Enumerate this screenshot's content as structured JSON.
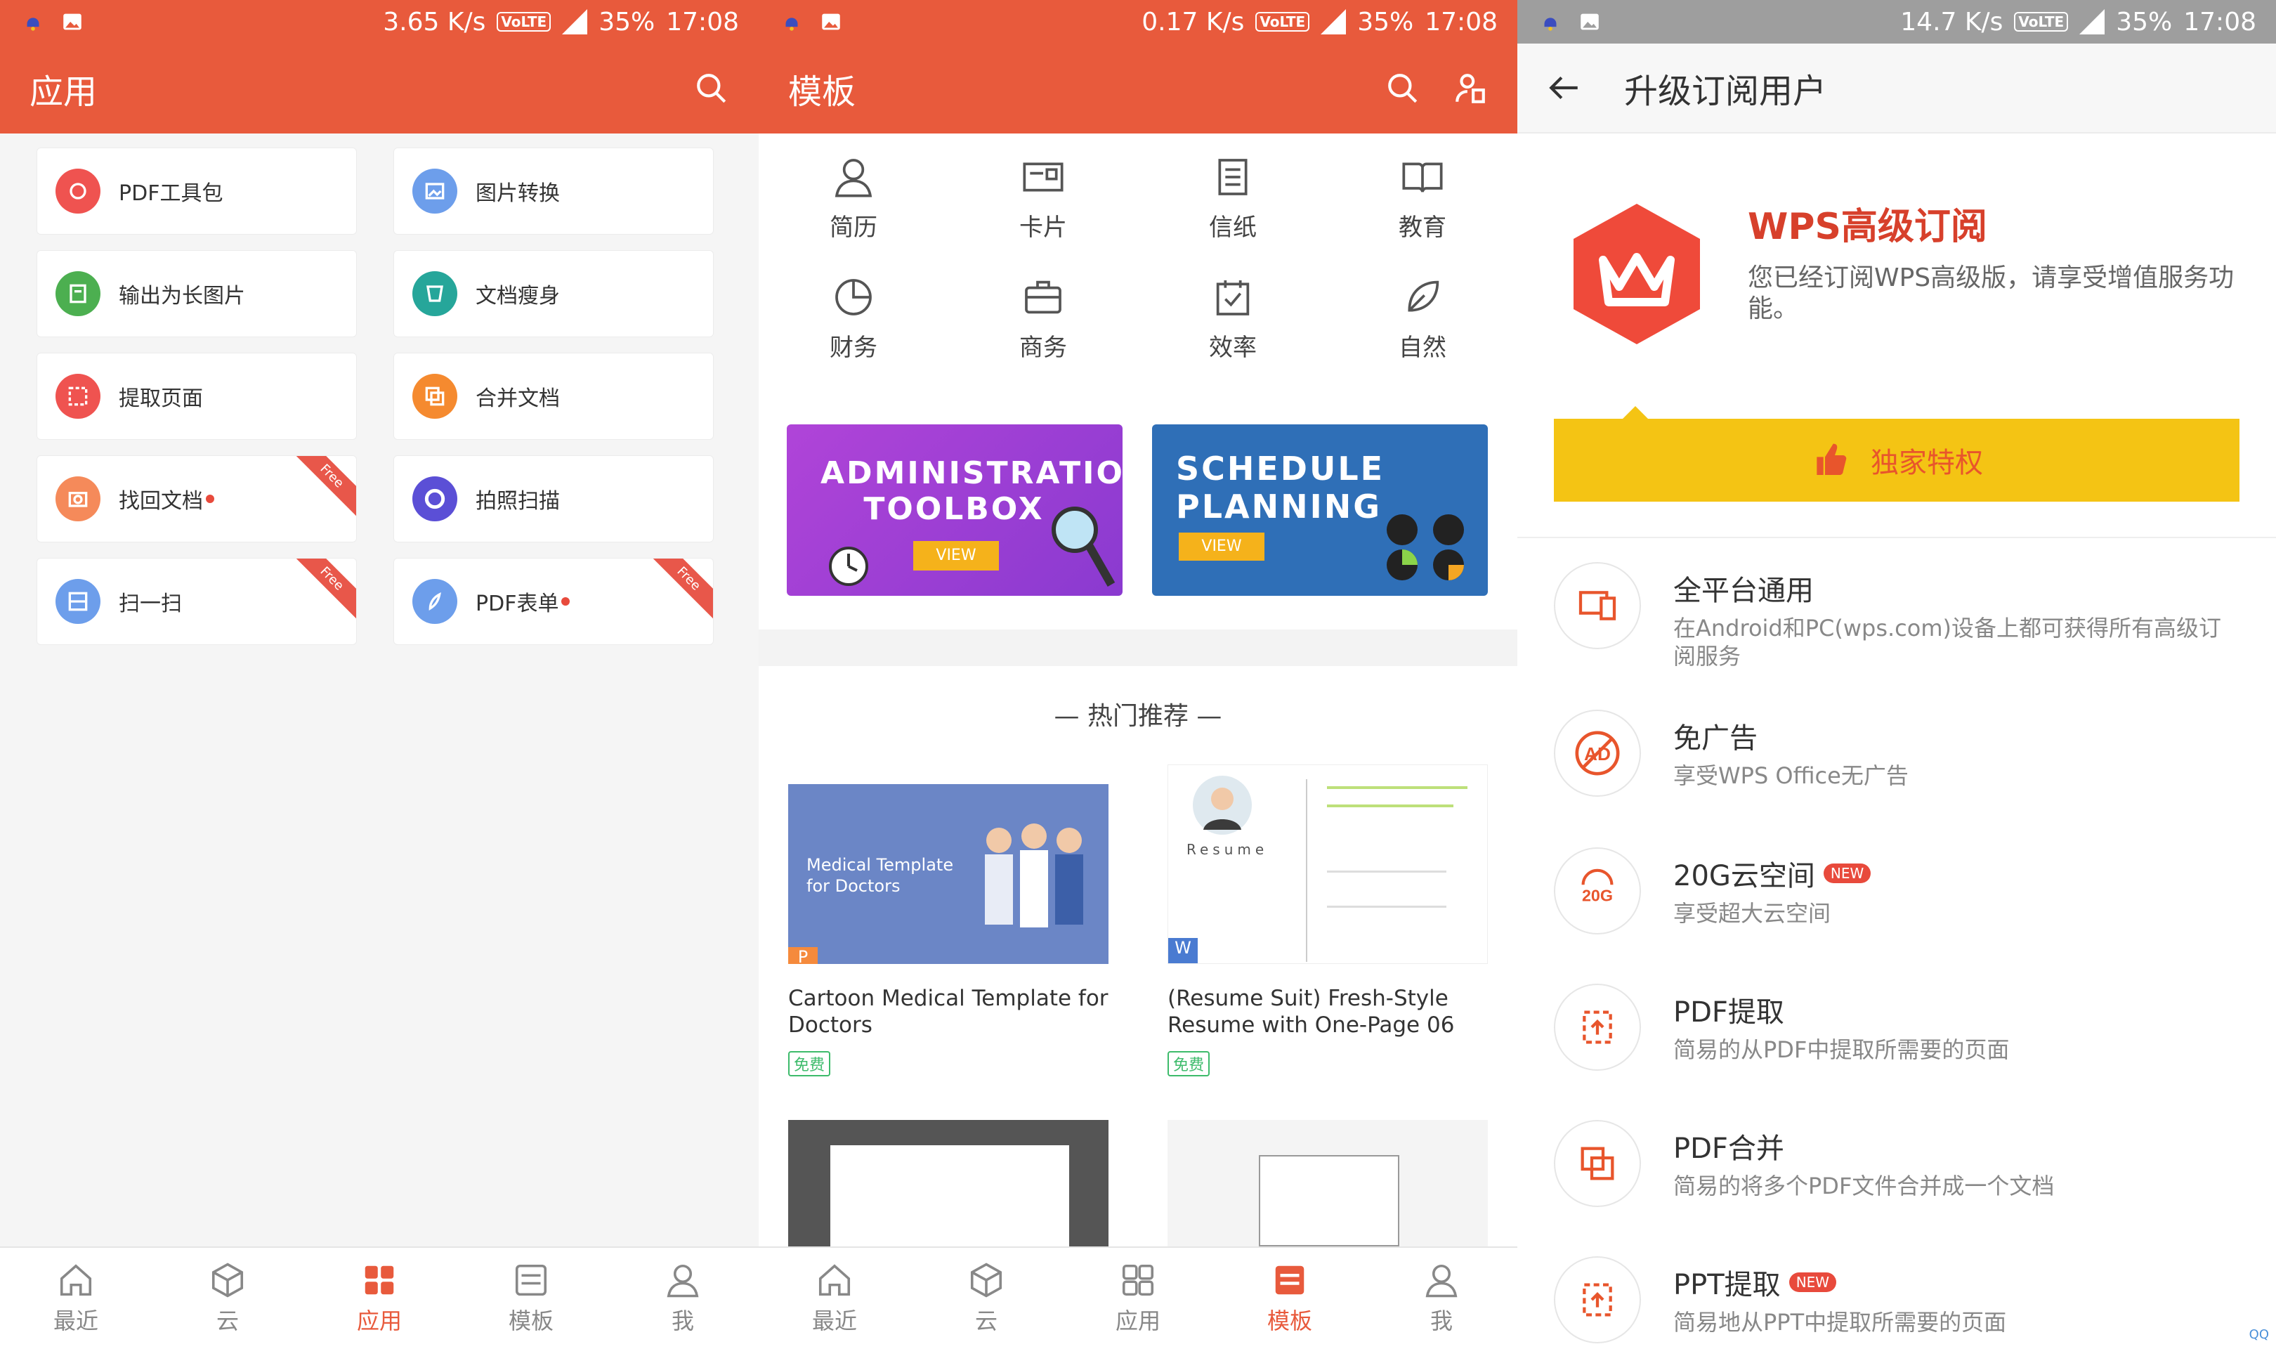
{
  "panels": {
    "apps": {
      "status": {
        "speed": "3.65 K/s",
        "battery": "35%",
        "time": "17:08"
      },
      "title": "应用",
      "tools": [
        {
          "label": "PDF工具包",
          "color": "#ef5350",
          "dot": false,
          "ribbon": false
        },
        {
          "label": "图片转换",
          "color": "#6d9eeb",
          "dot": false,
          "ribbon": false
        },
        {
          "label": "输出为长图片",
          "color": "#4caf50",
          "dot": false,
          "ribbon": false
        },
        {
          "label": "文档瘦身",
          "color": "#26a69a",
          "dot": false,
          "ribbon": false
        },
        {
          "label": "提取页面",
          "color": "#ef5350",
          "dot": false,
          "ribbon": false
        },
        {
          "label": "合并文档",
          "color": "#f58a2f",
          "dot": false,
          "ribbon": false
        },
        {
          "label": "找回文档",
          "color": "#f58a5a",
          "dot": true,
          "ribbon": true
        },
        {
          "label": "拍照扫描",
          "color": "#5b4fd6",
          "dot": false,
          "ribbon": false
        },
        {
          "label": "扫一扫",
          "color": "#6d9eeb",
          "dot": false,
          "ribbon": true
        },
        {
          "label": "PDF表单",
          "color": "#6d9eeb",
          "dot": true,
          "ribbon": true
        }
      ],
      "ribbon_text": "Free",
      "nav": [
        {
          "label": "最近",
          "active": false
        },
        {
          "label": "云",
          "active": false
        },
        {
          "label": "应用",
          "active": true
        },
        {
          "label": "模板",
          "active": false
        },
        {
          "label": "我",
          "active": false
        }
      ]
    },
    "templates": {
      "status": {
        "speed": "0.17 K/s",
        "battery": "35%",
        "time": "17:08"
      },
      "title": "模板",
      "categories": [
        "简历",
        "卡片",
        "信纸",
        "教育",
        "财务",
        "商务",
        "效率",
        "自然"
      ],
      "banners": [
        {
          "line1": "ADMINISTRATION",
          "line2": "TOOLBOX",
          "view": "VIEW"
        },
        {
          "line1": "SCHEDULE",
          "line2": "PLANNING",
          "view": "VIEW"
        }
      ],
      "hot_title": "— 热门推荐 —",
      "cards": [
        {
          "title": "Cartoon Medical Template for Doctors",
          "thumb_text": "Medical Template for Doctors",
          "tag": "免费"
        },
        {
          "title": "(Resume Suit) Fresh-Style Resume with One-Page 06",
          "thumb_text": "Resume",
          "tag": "免费"
        }
      ],
      "nav": [
        {
          "label": "最近",
          "active": false
        },
        {
          "label": "云",
          "active": false
        },
        {
          "label": "应用",
          "active": false
        },
        {
          "label": "模板",
          "active": true
        },
        {
          "label": "我",
          "active": false
        }
      ]
    },
    "upgrade": {
      "status": {
        "speed": "14.7 K/s",
        "battery": "35%",
        "time": "17:08"
      },
      "title": "升级订阅用户",
      "sub_title": "WPS高级订阅",
      "sub_desc": "您已经订阅WPS高级版，请享受增值服务功能。",
      "exclusive": "独家特权",
      "features": [
        {
          "title": "全平台通用",
          "desc": "在Android和PC(wps.com)设备上都可获得所有高级订阅服务",
          "badge": ""
        },
        {
          "title": "免广告",
          "desc": "享受WPS Office无广告",
          "badge": ""
        },
        {
          "title": "20G云空间",
          "desc": "享受超大云空间",
          "badge": "NEW"
        },
        {
          "title": "PDF提取",
          "desc": "简易的从PDF中提取所需要的页面",
          "badge": ""
        },
        {
          "title": "PDF合并",
          "desc": "简易的将多个PDF文件合并成一个文档",
          "badge": ""
        },
        {
          "title": "PPT提取",
          "desc": "简易地从PPT中提取所需要的页面",
          "badge": "NEW"
        }
      ],
      "ad_text": "AD",
      "storage_text": "20G"
    }
  },
  "colors": {
    "accent": "#e85a3c",
    "gold": "#f4c414",
    "green": "#3dbb6b"
  }
}
